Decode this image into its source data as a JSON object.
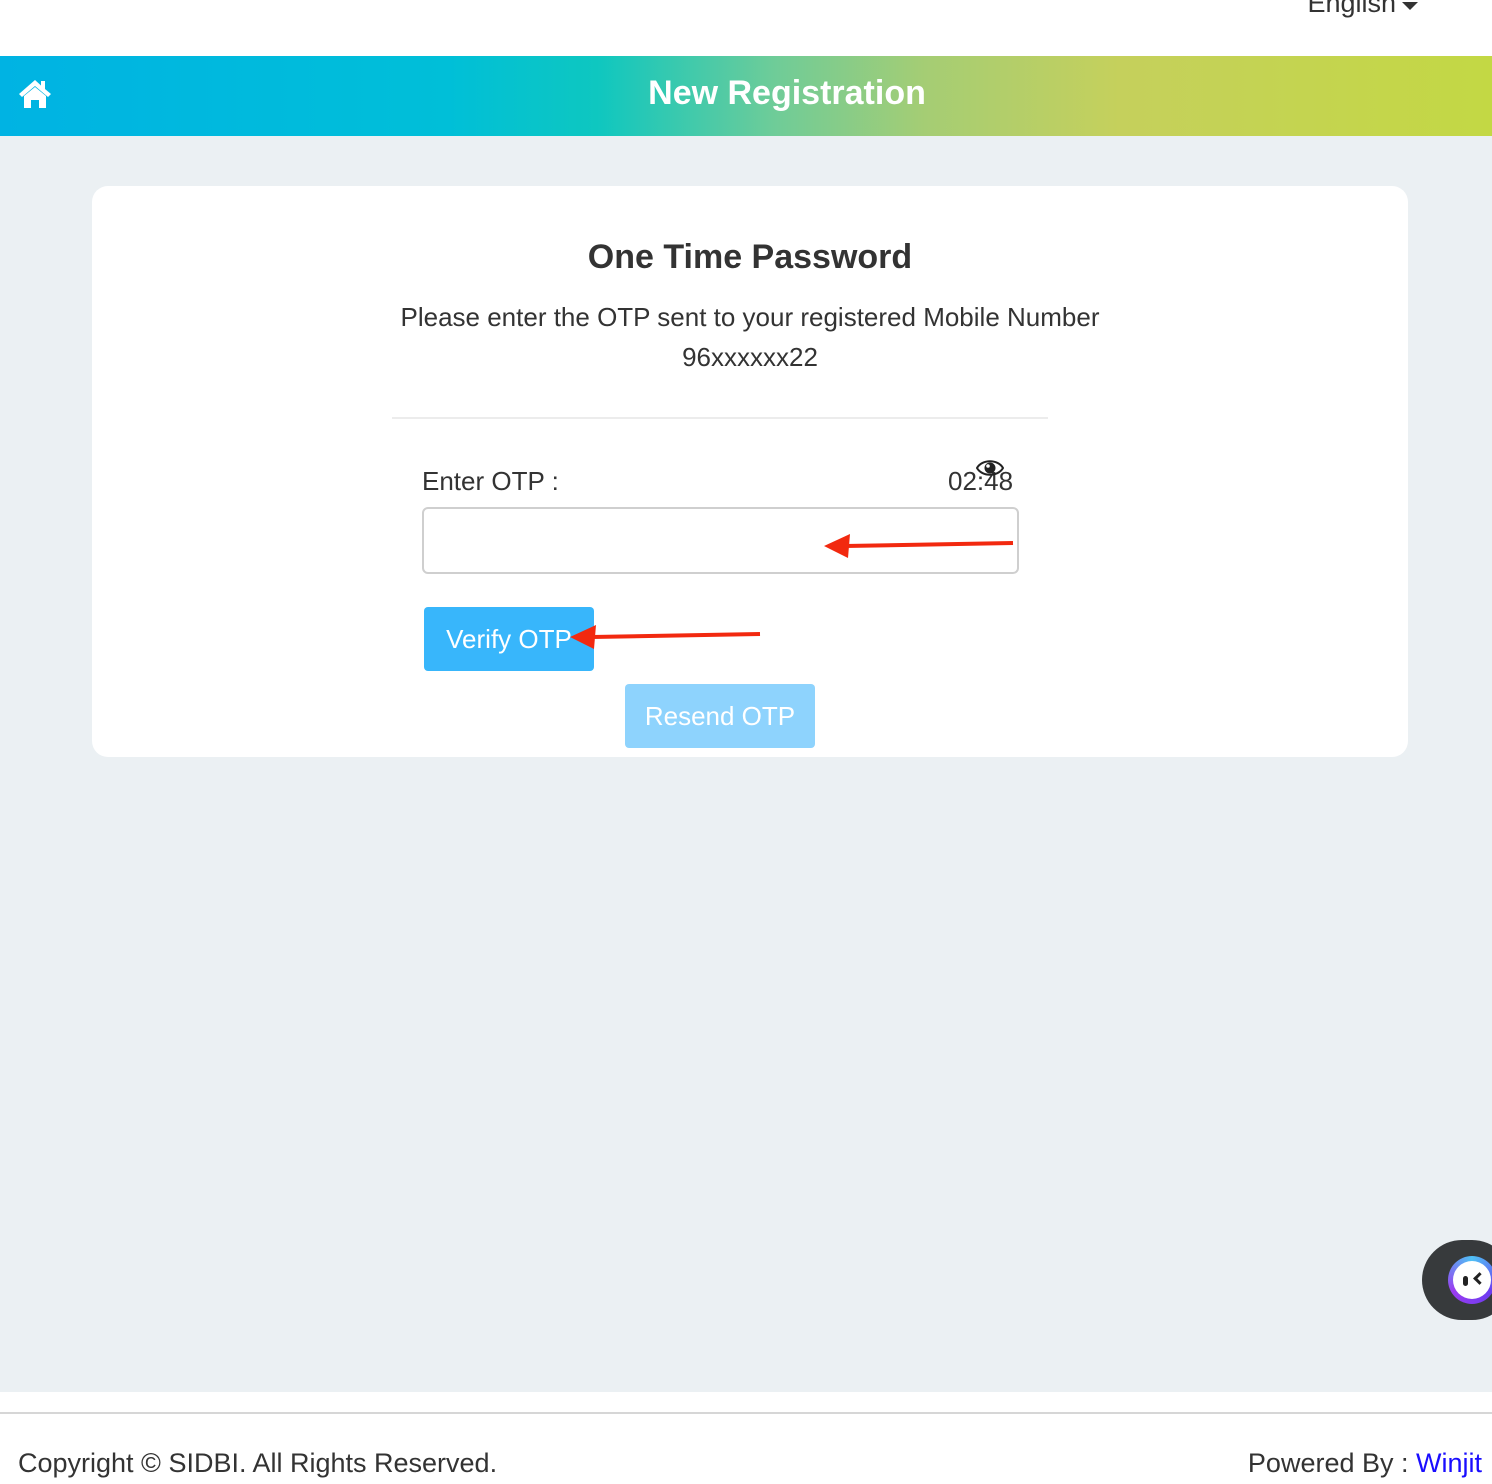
{
  "topbar": {
    "language_selected": "English",
    "language_icon": "caret-down-icon"
  },
  "header": {
    "home_icon": "home-icon",
    "title": "New Registration",
    "gradient_colors": [
      "#00b3e3",
      "#0ec7c0",
      "#a5cd74",
      "#c3d844"
    ]
  },
  "card": {
    "title": "One Time Password",
    "description": "Please enter the OTP sent to your registered Mobile Number",
    "mobile_number": "96xxxxxx22",
    "otp_label": "Enter OTP :",
    "timer": "02:48",
    "eye_icon": "eye-icon",
    "otp_value": "",
    "otp_placeholder": "",
    "verify_label": "Verify OTP",
    "resend_label": "Resend OTP",
    "verify_color": "#38b6fb",
    "resend_color": "#8ed3fd"
  },
  "annotations": {
    "arrow_color": "#f2290f",
    "arrows": [
      "points-to-otp-input",
      "points-to-verify-button"
    ]
  },
  "chat_widget": {
    "icon": "chatbot-icon"
  },
  "footer": {
    "copyright": "Copyright © SIDBI. All Rights Reserved.",
    "powered_by_label": "Powered By : ",
    "powered_by_link": "Winjit",
    "link_color": "#1a0dff"
  }
}
